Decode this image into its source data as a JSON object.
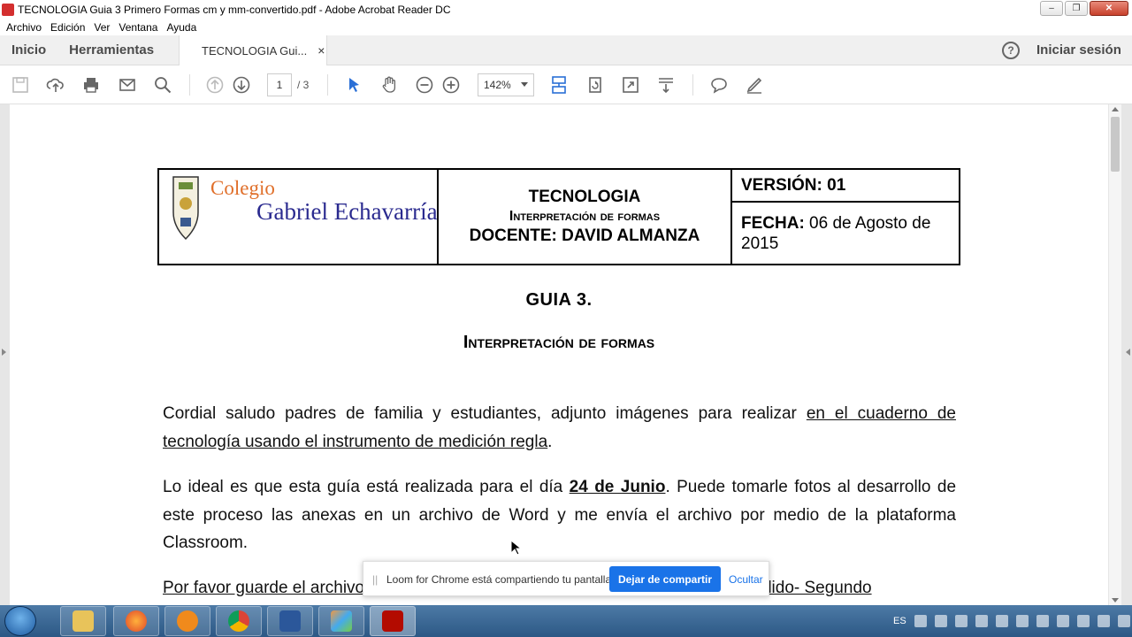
{
  "window": {
    "title": "TECNOLOGIA  Guia 3 Primero Formas cm y mm-convertido.pdf - Adobe Acrobat Reader DC"
  },
  "menu": [
    "Archivo",
    "Edición",
    "Ver",
    "Ventana",
    "Ayuda"
  ],
  "tabs": {
    "home": "Inicio",
    "tools": "Herramientas",
    "document": "TECNOLOGIA  Gui...",
    "close": "×",
    "help": "?",
    "signin": "Iniciar sesión"
  },
  "toolbar": {
    "page_current": "1",
    "page_total": "/  3",
    "zoom": "142%"
  },
  "document": {
    "header": {
      "colegio": "Colegio",
      "school_name": "Gabriel Echavarría",
      "subject": "TECNOLOGIA",
      "topic": "Interpretación de formas",
      "teacher": "DOCENTE: DAVID ALMANZA",
      "version": "VERSIÓN: 01",
      "date_label": "FECHA:",
      "date_value": " 06 de Agosto de 2015"
    },
    "guide_title": "GUIA 3.",
    "guide_subtitle": "Interpretación de formas",
    "p1_a": "Cordial saludo padres de familia y estudiantes, adjunto imágenes para realizar ",
    "p1_u": "en el cuaderno de tecnología usando el instrumento de medición regla",
    "p1_b": ".",
    "p2_a": "Lo ideal es que esta guía está realizada para el día ",
    "p2_date": "24 de Junio",
    "p2_b": ". Puede tomarle fotos al desarrollo de este proceso las anexas en un archivo de Word y me envía el archivo por medio de la plataforma Classroom.",
    "p3_u": "Por favor guarde el archivo de la siguiente forma: Nombre Completo- Primer Apellido- Segundo"
  },
  "loom": {
    "grip": "||",
    "message": "Loom for Chrome está compartiendo tu pantalla.",
    "stop": "Dejar de compartir",
    "hide": "Ocultar"
  },
  "taskbar": {
    "lang": "ES"
  },
  "colors": {
    "accent": "#1a73e8",
    "colegio": "#e06f2a",
    "school_name": "#2a2a8f"
  }
}
